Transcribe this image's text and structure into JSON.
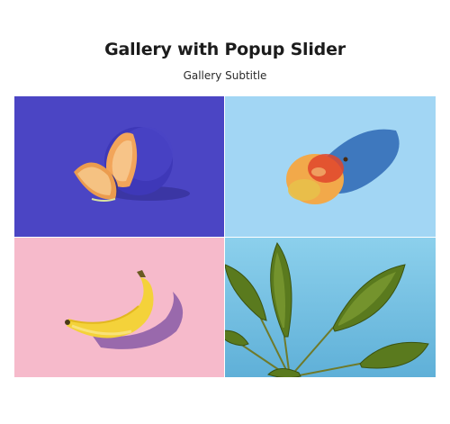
{
  "gallery": {
    "title": "Gallery with Popup Slider",
    "subtitle": "Gallery Subtitle",
    "items": [
      {
        "name": "melon",
        "background": "#4b45c4"
      },
      {
        "name": "mango",
        "background": "#a2d6f4"
      },
      {
        "name": "banana",
        "background": "#f6bacb"
      },
      {
        "name": "leaves",
        "background": "#7ec6e6"
      }
    ]
  }
}
